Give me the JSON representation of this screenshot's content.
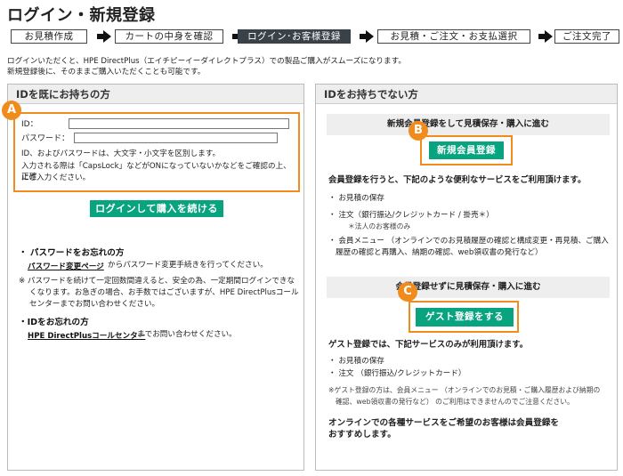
{
  "page": {
    "title": "ログイン・新規登録"
  },
  "steps": [
    {
      "label": "お見積作成"
    },
    {
      "label": "カートの中身を確認"
    },
    {
      "label": "ログイン･お客様登録"
    },
    {
      "label": "お見積・ご注文・お支払選択"
    },
    {
      "label": "ご注文完了"
    }
  ],
  "intro": {
    "line1": "ログインいただくと、HPE DirectPlus（エイチピーイーダイレクトプラス）での製品ご購入がスムーズになります。",
    "line2": "新規登録後に、そのままご購入いただくことも可能です。"
  },
  "markers": {
    "a": "A",
    "b": "B",
    "c": "C"
  },
  "left": {
    "header": "IDを既にお持ちの方",
    "id_label": "ID：",
    "id_value": "",
    "password_label": "パスワード：",
    "password_value": "",
    "note1": "ID、およびパスワードは、大文字・小文字を区別します。",
    "note2": "入力される際は「CapsLock」などがONになっていないかなどをご確認の上、正確",
    "note3": "にご入力ください。",
    "login_button": "ログインして購入を続ける",
    "forgot_password_title": "・ パスワードをお忘れの方",
    "password_change_link": "パスワード変更ページ",
    "password_change_text": "からパスワード変更手続きを行ってください。",
    "lock_note1": "※ パスワードを続けて一定回数間違えると、安全の為、一定期間ログインできな",
    "lock_note2": "くなります。お急ぎの場合、お手数ではございますが、HPE DirectPlusコール",
    "lock_note3": "センターまでお問い合わせください。",
    "forgot_id_title": "・IDをお忘れの方",
    "call_center_link": "HPE DirectPlusコールセンター",
    "call_center_text": "までお問い合わせください。"
  },
  "right": {
    "header": "IDをお持ちでない方",
    "member_subhead": "新規会員登録をして見積保存・購入に進む",
    "member_button": "新規会員登録",
    "member_lead": "会員登録を行うと、下記のような便利なサービスをご利用頂けます。",
    "member_item1": "・ お見積の保存",
    "member_item2": "・ 注文（銀行振込/クレジットカード / 掛売＊）",
    "member_item2_note": "＊法人のお客様のみ",
    "member_item3a": "・ 会員メニュー （オンラインでのお見積履歴の確認と構成変更・再見積、ご購入",
    "member_item3b": "履歴の確認と再購入、納期の確認、web領収書の発行など）",
    "guest_subhead": "会員登録せずに見積保存・購入に進む",
    "guest_button": "ゲスト登録をする",
    "guest_lead": "ゲスト登録では、下記サービスのみが利用頂けます。",
    "guest_item1": "・ お見積の保存",
    "guest_item2": "・ 注文 （銀行振込/クレジットカード）",
    "guest_note1": "※ゲスト登録の方は、会員メニュー （オンラインでのお見積・ご購入履歴および納期の",
    "guest_note2": "確認、web領収書の発行など） のご利用はできませんのでご注意ください。",
    "recommend1": "オンラインでの各種サービスをご希望のお客様は会員登録を",
    "recommend2": "おすすめします。"
  }
}
